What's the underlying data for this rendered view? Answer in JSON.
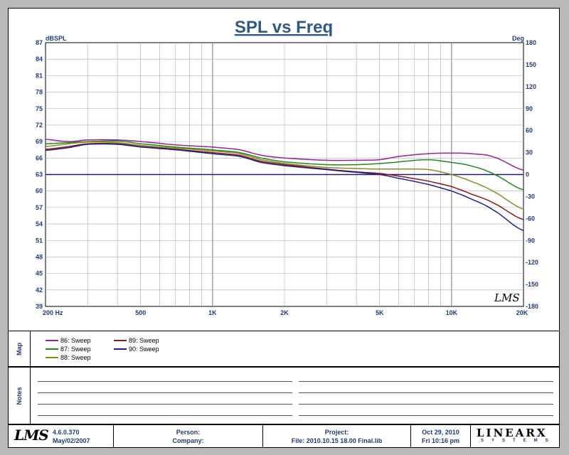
{
  "chart_data": {
    "type": "line",
    "title": "SPL vs Freq",
    "y_left_label": "dBSPL",
    "y_right_label": "Deg",
    "x_scale": "log",
    "xlim": [
      200,
      20000
    ],
    "ylim_left": [
      39,
      87
    ],
    "ylim_right": [
      -180,
      180
    ],
    "grid": true,
    "x_tick_labels": [
      {
        "value": 200,
        "label": "200  Hz"
      },
      {
        "value": 500,
        "label": "500"
      },
      {
        "value": 1000,
        "label": "1K"
      },
      {
        "value": 2000,
        "label": "2K"
      },
      {
        "value": 5000,
        "label": "5K"
      },
      {
        "value": 10000,
        "label": "10K"
      },
      {
        "value": 20000,
        "label": "20K"
      }
    ],
    "y_left_ticks": [
      87,
      84,
      81,
      78,
      75,
      72,
      69,
      66,
      63,
      60,
      57,
      54,
      51,
      48,
      45,
      42,
      39
    ],
    "y_right_ticks": [
      180,
      150,
      120,
      90,
      60,
      30,
      0,
      -30,
      -60,
      -90,
      -120,
      -150,
      -180
    ],
    "reference_line": {
      "y": 63,
      "color": "#1a1a7a"
    },
    "series": [
      {
        "name": "86: Sweep",
        "color": "#9b1f9b",
        "x": [
          200,
          250,
          300,
          400,
          500,
          700,
          1000,
          1300,
          1600,
          2000,
          3000,
          4000,
          5000,
          6000,
          8000,
          10000,
          12000,
          15000,
          20000
        ],
        "y": [
          69.4,
          69.0,
          69.3,
          69.3,
          69.0,
          68.4,
          68.0,
          67.5,
          66.5,
          66.0,
          65.6,
          65.6,
          65.7,
          66.3,
          66.8,
          66.9,
          66.8,
          66.2,
          63.8
        ]
      },
      {
        "name": "87: Sweep",
        "color": "#1f8a1f",
        "x": [
          200,
          250,
          300,
          400,
          500,
          700,
          1000,
          1300,
          1600,
          2000,
          3000,
          4000,
          5000,
          6000,
          8000,
          10000,
          12000,
          15000,
          20000
        ],
        "y": [
          68.6,
          68.8,
          69.0,
          69.1,
          68.6,
          68.0,
          67.5,
          67.0,
          66.0,
          65.3,
          64.8,
          64.8,
          65.0,
          65.3,
          65.7,
          65.2,
          64.6,
          63.1,
          60.2
        ]
      },
      {
        "name": "88: Sweep",
        "color": "#8c8c1f",
        "x": [
          200,
          250,
          300,
          400,
          500,
          700,
          1000,
          1300,
          1600,
          2000,
          3000,
          4000,
          5000,
          6000,
          8000,
          10000,
          12000,
          15000,
          20000
        ],
        "y": [
          68.1,
          68.6,
          68.9,
          68.8,
          68.3,
          67.8,
          67.3,
          66.8,
          65.7,
          65.0,
          64.3,
          64.1,
          64.0,
          64.0,
          63.9,
          63.0,
          61.8,
          59.9,
          56.7
        ]
      },
      {
        "name": "89: Sweep",
        "color": "#8b1a1a",
        "x": [
          200,
          250,
          300,
          400,
          500,
          700,
          1000,
          1300,
          1600,
          2000,
          3000,
          4000,
          5000,
          6000,
          8000,
          10000,
          12000,
          15000,
          20000
        ],
        "y": [
          67.6,
          68.1,
          68.6,
          68.6,
          68.1,
          67.6,
          67.0,
          66.5,
          65.4,
          64.8,
          64.0,
          63.5,
          63.2,
          62.7,
          61.8,
          60.8,
          59.5,
          57.8,
          54.8
        ]
      },
      {
        "name": "90: Sweep",
        "color": "#1f1f8b",
        "x": [
          200,
          250,
          300,
          400,
          500,
          700,
          1000,
          1300,
          1600,
          2000,
          3000,
          4000,
          5000,
          6000,
          8000,
          10000,
          12000,
          15000,
          20000
        ],
        "y": [
          67.4,
          67.9,
          68.5,
          68.5,
          68.0,
          67.5,
          66.8,
          66.3,
          65.2,
          64.6,
          63.9,
          63.4,
          63.0,
          62.3,
          61.2,
          60.0,
          58.6,
          56.5,
          52.8
        ]
      }
    ]
  },
  "watermark_logo": "LMS",
  "panels": {
    "map_label": "Map",
    "notes_label": "Notes"
  },
  "footer": {
    "version": "4.6.0.370",
    "version_date": "May/02/2007",
    "person_label": "Person:",
    "company_label": "Company:",
    "project_label": "Project:",
    "file_label": "File: 2010.10.15 18.00 Final.lib",
    "date": "Oct 29, 2010",
    "time": "Fri 10:16 pm",
    "logo_left": "LMS",
    "brand_logo": "LINEARX",
    "brand_sub": "SYSTEMS"
  }
}
